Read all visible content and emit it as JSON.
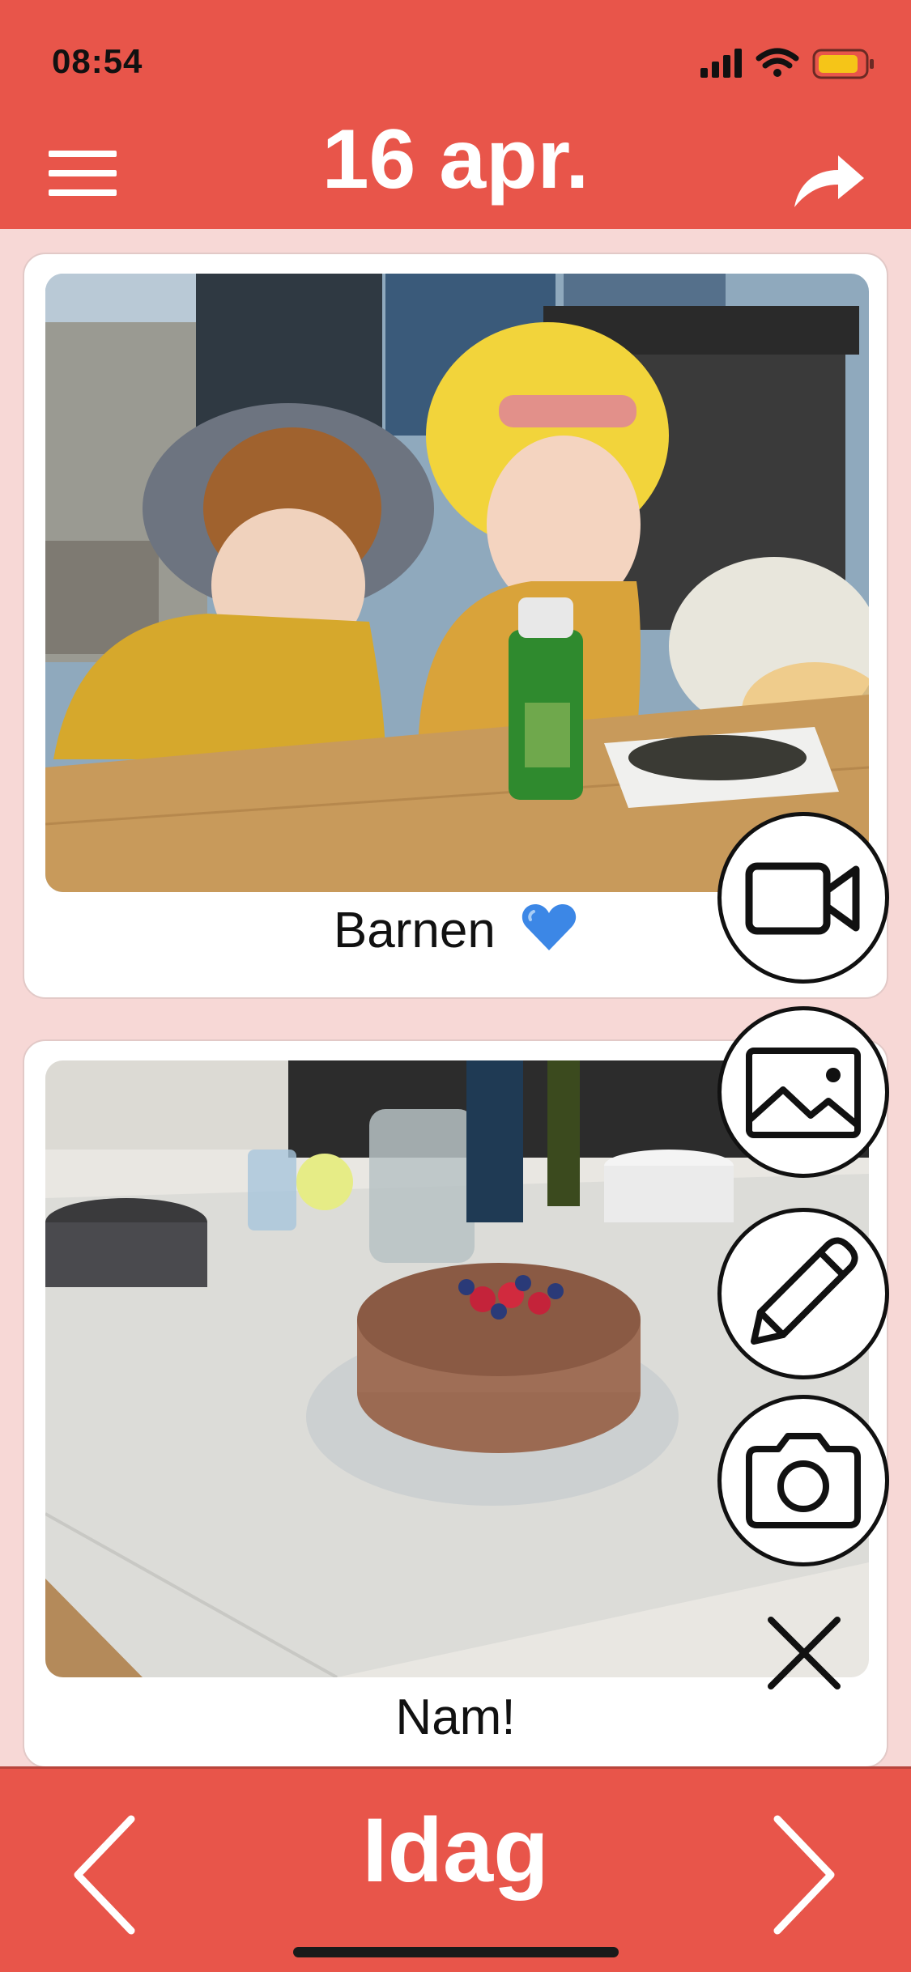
{
  "status_bar": {
    "time": "08:54",
    "signal_icon": "cellular-signal-icon",
    "wifi_icon": "wifi-icon",
    "battery_icon": "battery-icon",
    "battery_color": "#f5c518"
  },
  "header": {
    "title": "16 apr.",
    "menu_icon": "hamburger-menu-icon",
    "share_icon": "share-arrow-icon",
    "background_color": "#e8554a"
  },
  "entries": [
    {
      "photo": "photo-children-at-table",
      "caption": "Barnen",
      "emoji": "blue-heart-icon"
    },
    {
      "photo": "photo-chocolate-cake",
      "caption": "Nam!"
    }
  ],
  "actions": [
    {
      "name": "video",
      "icon": "video-camera-icon"
    },
    {
      "name": "image",
      "icon": "image-gallery-icon"
    },
    {
      "name": "text",
      "icon": "pencil-icon"
    },
    {
      "name": "camera",
      "icon": "camera-icon"
    },
    {
      "name": "close",
      "icon": "close-icon"
    }
  ],
  "footer": {
    "label": "Idag",
    "prev_icon": "chevron-left-icon",
    "next_icon": "chevron-right-icon"
  }
}
